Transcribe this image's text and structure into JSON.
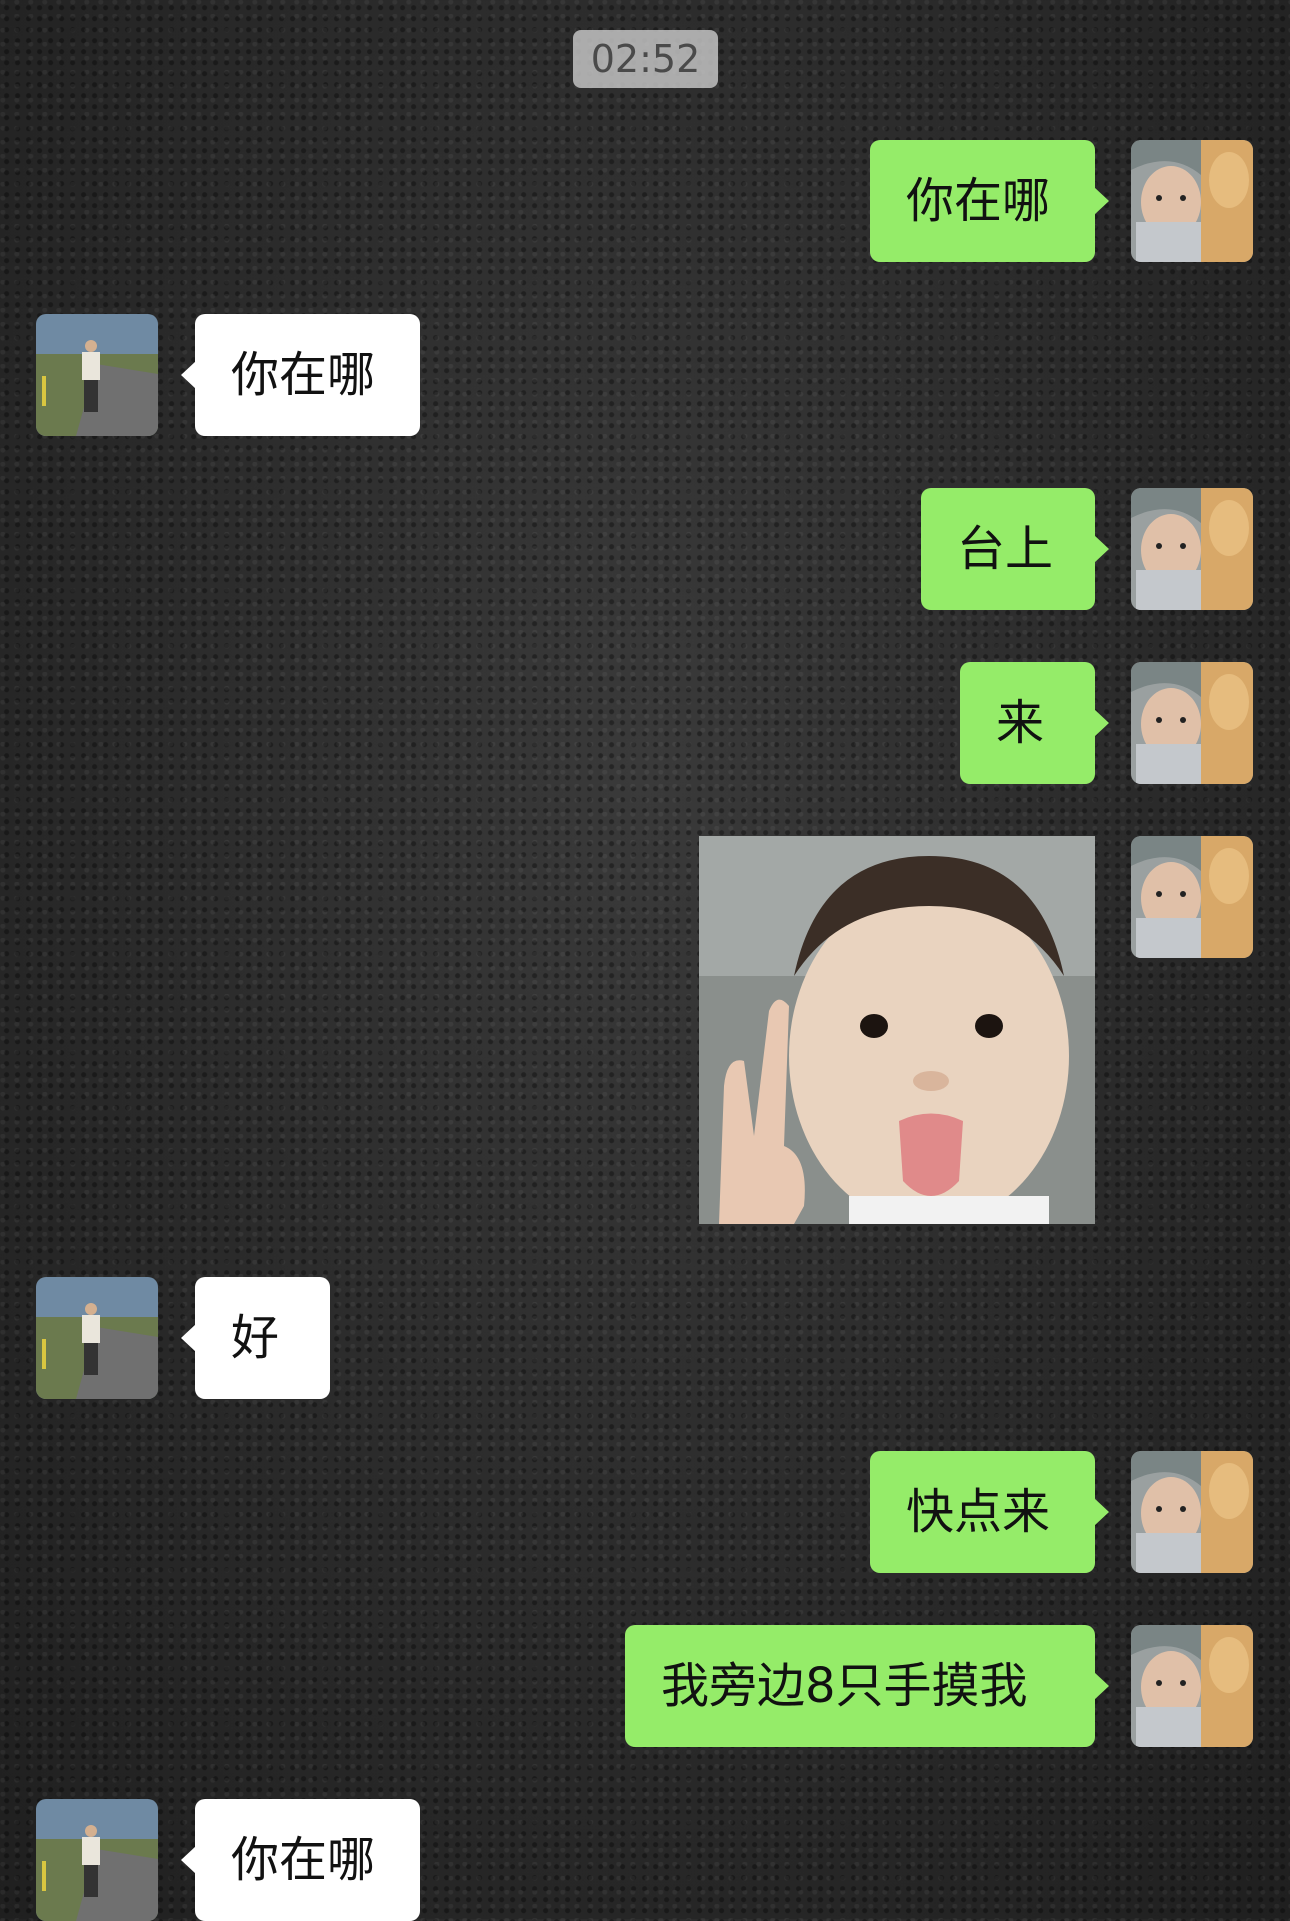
{
  "chat": {
    "timestamp": "02:52",
    "messages": [
      {
        "from": "self",
        "text": "你在哪"
      },
      {
        "from": "peer",
        "text": "你在哪"
      },
      {
        "from": "self",
        "text": "台上"
      },
      {
        "from": "self",
        "text": "来"
      },
      {
        "from": "self",
        "type": "sticker",
        "sticker": "baby-peace-sign-tongue-out"
      },
      {
        "from": "peer",
        "text": "好"
      },
      {
        "from": "self",
        "text": "快点来"
      },
      {
        "from": "self",
        "text": "我旁边8只手摸我"
      },
      {
        "from": "peer",
        "text": "你在哪"
      }
    ]
  },
  "colors": {
    "sent_bubble": "#95ec69",
    "received_bubble": "#ffffff",
    "background": "#2a2a2a",
    "timestamp_bg": "#c8c8c8"
  }
}
